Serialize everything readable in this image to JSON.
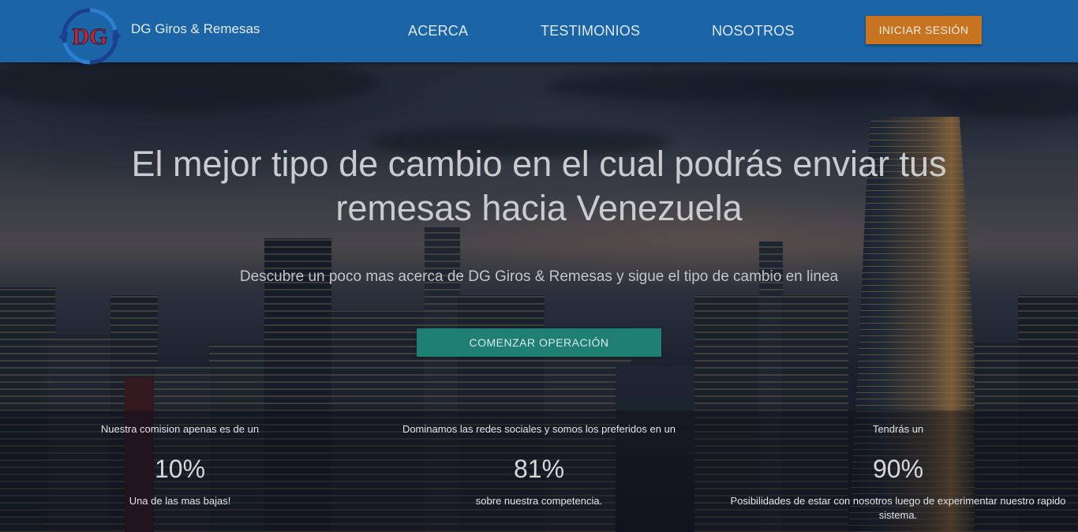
{
  "nav": {
    "brand": "DG Giros & Remesas",
    "logo_text": "DG",
    "links": [
      "ACERCA",
      "TESTIMONIOS",
      "NOSOTROS"
    ],
    "login_label": "INICIAR SESIÓN"
  },
  "hero": {
    "title": "El mejor tipo de cambio en el cual podrás enviar tus remesas hacia Venezuela",
    "subtitle": "Descubre un poco mas acerca de DG Giros & Remesas y sigue el tipo de cambio en linea",
    "cta_label": "COMENZAR OPERACIÓN"
  },
  "stats": [
    {
      "lead": "Nuestra comision apenas es de un",
      "value": "10%",
      "tail": "Una de las mas bajas!"
    },
    {
      "lead": "Dominamos las redes sociales y somos los preferidos en un",
      "value": "81%",
      "tail": "sobre nuestra competencia."
    },
    {
      "lead": "Tendrás un",
      "value": "90%",
      "tail": "Posibilidades de estar con nosotros luego de experimentar nuestro rapido sistema."
    }
  ],
  "colors": {
    "nav_bg": "#1b64a6",
    "login_btn": "#c8731f",
    "cta_btn": "#1f7f72"
  }
}
